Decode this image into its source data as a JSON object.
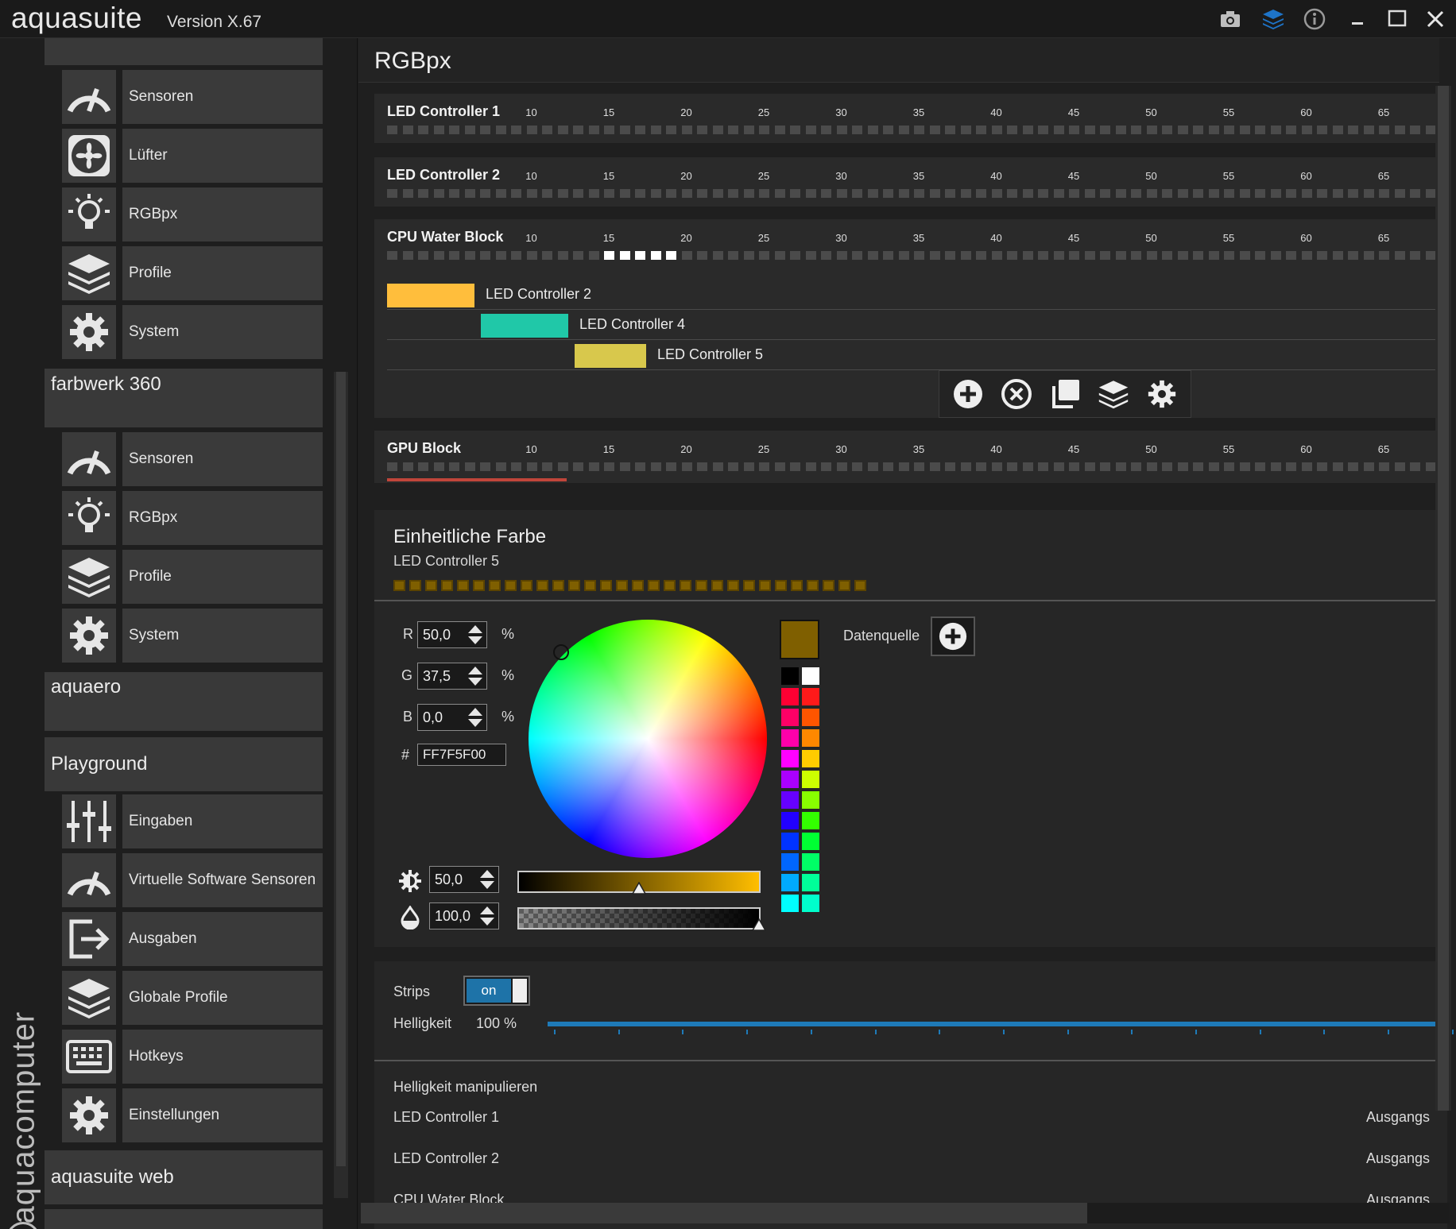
{
  "app": {
    "logo": "aquasuite",
    "version": "Version X.67",
    "brand_vertical": "aquacomputer"
  },
  "titlebar_icons": [
    "camera-icon",
    "layers-icon",
    "info-icon",
    "minimize-icon",
    "maximize-icon",
    "close-icon"
  ],
  "sidebar": {
    "groups": [
      {
        "title": "",
        "items": [
          {
            "label": "Sensoren",
            "icon": "gauge-icon"
          },
          {
            "label": "Lüfter",
            "icon": "fan-icon"
          },
          {
            "label": "RGBpx",
            "icon": "bulb-icon"
          },
          {
            "label": "Profile",
            "icon": "layers-icon"
          },
          {
            "label": "System",
            "icon": "gear-icon"
          }
        ]
      },
      {
        "title": "farbwerk 360",
        "items": [
          {
            "label": "Sensoren",
            "icon": "gauge-icon"
          },
          {
            "label": "RGBpx",
            "icon": "bulb-icon"
          },
          {
            "label": "Profile",
            "icon": "layers-icon"
          },
          {
            "label": "System",
            "icon": "gear-icon"
          }
        ]
      },
      {
        "title": "aquaero",
        "items": []
      },
      {
        "title": "Playground",
        "items": [
          {
            "label": "Eingaben",
            "icon": "sliders-icon"
          },
          {
            "label": "Virtuelle Software Sensoren",
            "icon": "gauge-icon"
          },
          {
            "label": "Ausgaben",
            "icon": "output-icon"
          },
          {
            "label": "Globale Profile",
            "icon": "layers-icon"
          },
          {
            "label": "Hotkeys",
            "icon": "keyboard-icon"
          },
          {
            "label": "Einstellungen",
            "icon": "gear-icon"
          }
        ]
      },
      {
        "title": "aquasuite web",
        "items": []
      }
    ]
  },
  "main": {
    "title": "RGBpx",
    "tick_labels": [
      "10",
      "15",
      "20",
      "25",
      "30",
      "35",
      "40",
      "45",
      "50",
      "55",
      "60",
      "65"
    ],
    "controllers": [
      {
        "name": "LED Controller 1"
      },
      {
        "name": "LED Controller 2"
      },
      {
        "name": "CPU Water Block",
        "active_leds": "15-19"
      },
      {
        "name": "GPU Block"
      }
    ],
    "cpu_assignments": [
      {
        "label": "LED Controller 2",
        "color": "#ffbe3c"
      },
      {
        "label": "LED Controller 4",
        "color": "#20c8a8"
      },
      {
        "label": "LED Controller 5",
        "color": "#d8c84c"
      }
    ],
    "tool_icons": [
      "plus-circle-icon",
      "close-circle-icon",
      "copy-icon",
      "layers-icon",
      "gear-icon"
    ],
    "color_panel": {
      "title": "Einheitliche Farbe",
      "subtitle": "LED Controller 5",
      "r_label": "R",
      "r_value": "50,0",
      "g_label": "G",
      "g_value": "37,5",
      "b_label": "B",
      "b_value": "0,0",
      "unit": "%",
      "hex_label": "#",
      "hex_value": "FF7F5F00",
      "brightness_value": "50,0",
      "opacity_value": "100,0",
      "brightness_level": 0.5,
      "opacity_level": 1.0,
      "datenquelle": "Datenquelle",
      "current_color": "#7f5f00",
      "palette": [
        "#000000",
        "#ffffff",
        "#ff0033",
        "#ff1a1a",
        "#ff0066",
        "#ff5500",
        "#ff00aa",
        "#ff8800",
        "#ff00ff",
        "#ffcc00",
        "#aa00ff",
        "#ccff00",
        "#6600ff",
        "#88ff00",
        "#2200ff",
        "#33ff00",
        "#0033ff",
        "#00ff33",
        "#0066ff",
        "#00ff66",
        "#00aaff",
        "#00ff99",
        "#00ffff",
        "#00ffcc"
      ]
    },
    "strips": {
      "label": "Strips",
      "toggle": "on",
      "helligkeit_label": "Helligkeit",
      "helligkeit_value": "100 %",
      "manipulate_title": "Helligkeit manipulieren",
      "rows": [
        {
          "name": "LED Controller 1",
          "value": "Ausgangs"
        },
        {
          "name": "LED Controller 2",
          "value": "Ausgangs"
        },
        {
          "name": "CPU Water Block",
          "value": "Ausgangs"
        }
      ]
    }
  }
}
